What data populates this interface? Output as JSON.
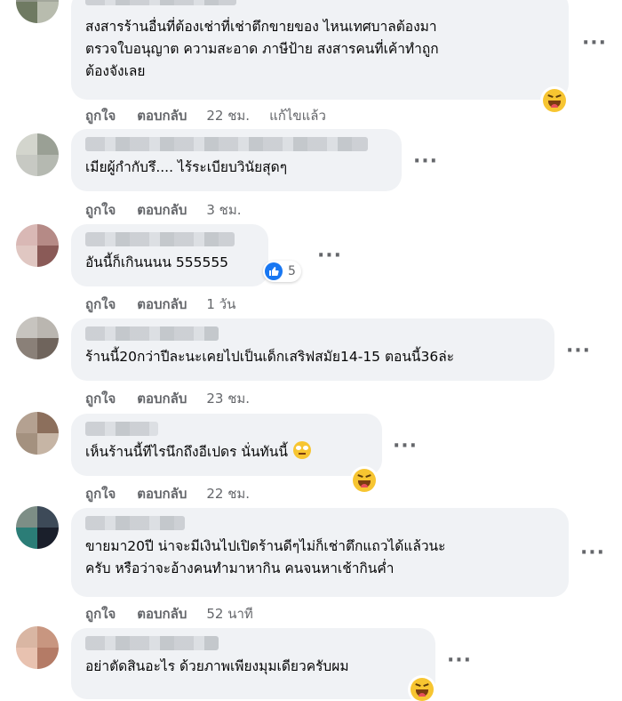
{
  "actions": {
    "like": "ถูกใจ",
    "reply": "ตอบกลับ",
    "edited": "แก้ไขแล้ว"
  },
  "comments": [
    {
      "text": "สงสารร้านอื่นที่ต้องเช่าที่เช่าตึกขายของ ไหนเทศบาลต้องมา\nตรวจใบอนุญาต ความสะอาด ภาษีป้าย สงสารคนที่เค้าทำถูก\nต้องจังเลย",
      "time": "22 ชม.",
      "reaction": "laugh-emoji"
    },
    {
      "text": "เมียผู้กำกับรึ.... ไร้ระเบียบวินัยสุดๆ",
      "time": "3 ชม."
    },
    {
      "text": "อันนี้ก็เกินนนน 555555",
      "time": "1 วัน",
      "like_count": "5"
    },
    {
      "text": "ร้านนี้20กว่าปีละนะเคยไปเป็นเด็กเสริฟสมัย14-15 ตอนนี้36ล่ะ",
      "time": "23 ชม."
    },
    {
      "text": "เห็นร้านนี้ทีไรนึกถึงอีเปดร นั่นทันนี้",
      "time": "22 ชม.",
      "reaction": "laugh-emoji"
    },
    {
      "text": "ขายมา20ปี น่าจะมีเงินไปเปิดร้านดีๆไม่ก็เช่าตึกแถวได้แล้วนะ\nครับ หรือว่าจะอ้างคนทำมาหากิน คนจนหาเช้ากินค่ำ",
      "time": "52 นาที"
    },
    {
      "text": "อย่าตัดสินอะไร ด้วยภาพเพียงมุมเดียวครับผม",
      "reaction": "laugh-emoji"
    }
  ],
  "colors": {
    "bubble": "#f0f2f5",
    "meta": "#65676b",
    "like_blue": "#1877f2"
  }
}
